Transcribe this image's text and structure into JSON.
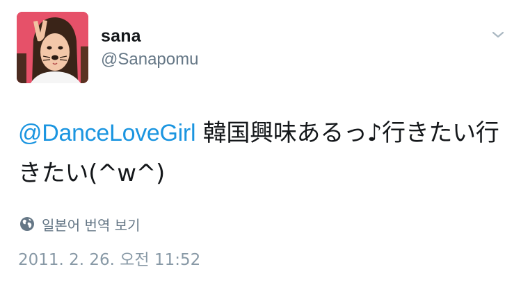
{
  "user": {
    "display_name": "sana",
    "handle": "@Sanapomu"
  },
  "tweet": {
    "mention": "@DanceLoveGirl",
    "text": " 韓国興味あるっ♪行きたい行きたい(^w^)"
  },
  "translate": {
    "label": "일본어 번역 보기"
  },
  "timestamp": "2011. 2. 26. 오전 11:52",
  "icons": {
    "menu": "chevron-down-icon",
    "translate": "globe-icon"
  },
  "colors": {
    "link": "#1b95e0",
    "secondary_text": "#657786",
    "timestamp": "#8899a6"
  }
}
